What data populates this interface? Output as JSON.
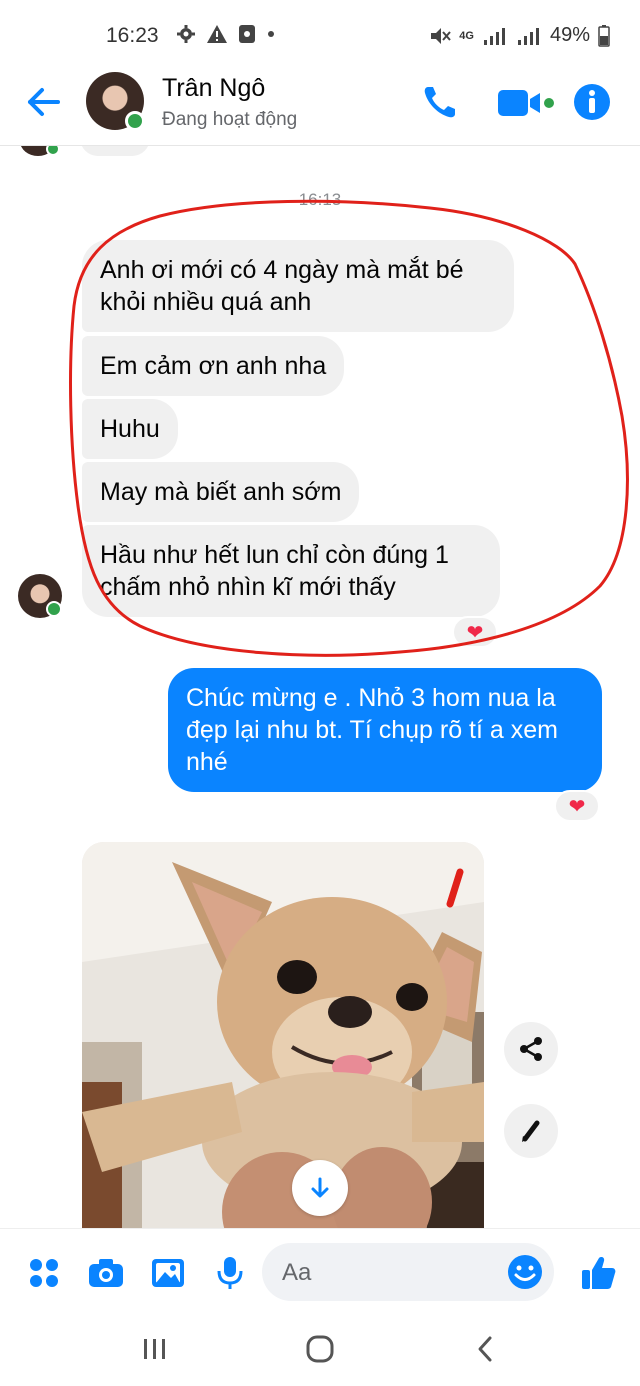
{
  "status_bar": {
    "time": "16:23",
    "battery": "49%",
    "network": "4G"
  },
  "header": {
    "contact_name": "Trân Ngô",
    "presence": "Đang hoạt động",
    "accent_color": "#0a84ff"
  },
  "chat": {
    "timestamp": "16:13",
    "incoming": [
      {
        "text": "Anh ơi mới có 4 ngày mà mắt bé khỏi nhiều quá anh"
      },
      {
        "text": "Em cảm ơn anh nha"
      },
      {
        "text": "Huhu"
      },
      {
        "text": "May mà biết anh sớm"
      },
      {
        "text": "Hầu như hết lun chỉ còn đúng 1 chấm nhỏ nhìn kĩ mới thấy"
      }
    ],
    "outgoing": {
      "text": "Chúc mừng e . Nhỏ 3 hom nua la đẹp lại nhu bt. Tí chụp rõ tí a xem nhé"
    },
    "reaction": "❤",
    "photo_icon": "download-icon"
  },
  "composer": {
    "placeholder": "Aa"
  }
}
